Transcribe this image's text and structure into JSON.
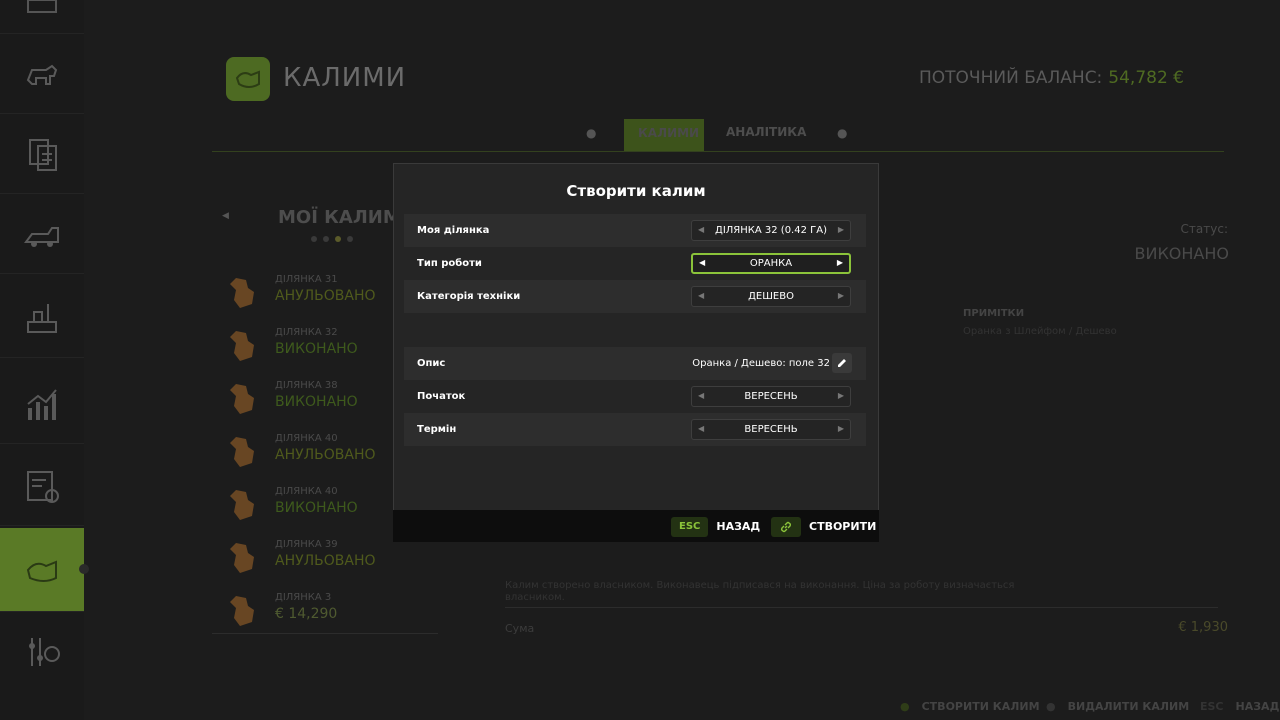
{
  "header": {
    "title": "КАЛИМИ",
    "balance_label": "ПОТОЧНИЙ БАЛАНС:",
    "balance_value": "54,782 €"
  },
  "tabs": [
    {
      "label": "КАЛИМИ",
      "active": true
    },
    {
      "label": "АНАЛІТИКА",
      "active": false
    }
  ],
  "sidebar": {
    "items": [
      {
        "icon": "map-icon"
      },
      {
        "icon": "animals-icon"
      },
      {
        "icon": "documents-icon"
      },
      {
        "icon": "vehicles-icon"
      },
      {
        "icon": "production-icon"
      },
      {
        "icon": "statistics-icon"
      },
      {
        "icon": "contracts-icon"
      },
      {
        "icon": "kalym-icon",
        "active": true
      },
      {
        "icon": "settings-icon"
      }
    ]
  },
  "list": {
    "title": "МОЇ КАЛИМИ",
    "items": [
      {
        "name": "ДІЛЯНКА 31",
        "status": "АНУЛЬОВАНО",
        "kind": "cancel"
      },
      {
        "name": "ДІЛЯНКА 32",
        "status": "ВИКОНАНО",
        "kind": "done"
      },
      {
        "name": "ДІЛЯНКА 38",
        "status": "ВИКОНАНО",
        "kind": "done"
      },
      {
        "name": "ДІЛЯНКА 40",
        "status": "АНУЛЬОВАНО",
        "kind": "cancel"
      },
      {
        "name": "ДІЛЯНКА 40",
        "status": "ВИКОНАНО",
        "kind": "done"
      },
      {
        "name": "ДІЛЯНКА 39",
        "status": "АНУЛЬОВАНО",
        "kind": "cancel"
      },
      {
        "name": "ДІЛЯНКА 3",
        "status": "€ 14,290",
        "kind": "money"
      }
    ]
  },
  "details": {
    "status_label": "Статус:",
    "status_value": "ВИКОНАНО",
    "notes_label": "ПРИМІТКИ",
    "notes_text": "Оранка з Шлейфом / Дешево",
    "paragraph": "Калим створено власником. Виконавець підписався на виконання. Ціна за роботу визначається власником.",
    "sum_label": "Сума",
    "sum_value": "€ 1,930"
  },
  "modal": {
    "title": "Створити калим",
    "rows": [
      {
        "label": "Моя ділянка",
        "value": "ДІЛЯНКА 32 (0.42 ГА)"
      },
      {
        "label": "Тип роботи",
        "value": "ОРАНКА"
      },
      {
        "label": "Категорія техніки",
        "value": "ДЕШЕВО"
      },
      {
        "label": "Опис",
        "value": "Оранка / Дешево: поле 32"
      },
      {
        "label": "Початок",
        "value": "ВЕРЕСЕНЬ"
      },
      {
        "label": "Термін",
        "value": "ВЕРЕСЕНЬ"
      }
    ],
    "back_key": "ESC",
    "back_label": "НАЗАД",
    "create_label": "СТВОРИТИ"
  },
  "footer": {
    "create": "СТВОРИТИ КАЛИМ",
    "delete": "ВИДАЛИТИ КАЛИМ",
    "esc_key": "ESC",
    "back": "НАЗАД"
  },
  "colors": {
    "accent": "#8bc33a",
    "sidebar_active": "#5a7a26",
    "field_icon": "#a8692a"
  }
}
